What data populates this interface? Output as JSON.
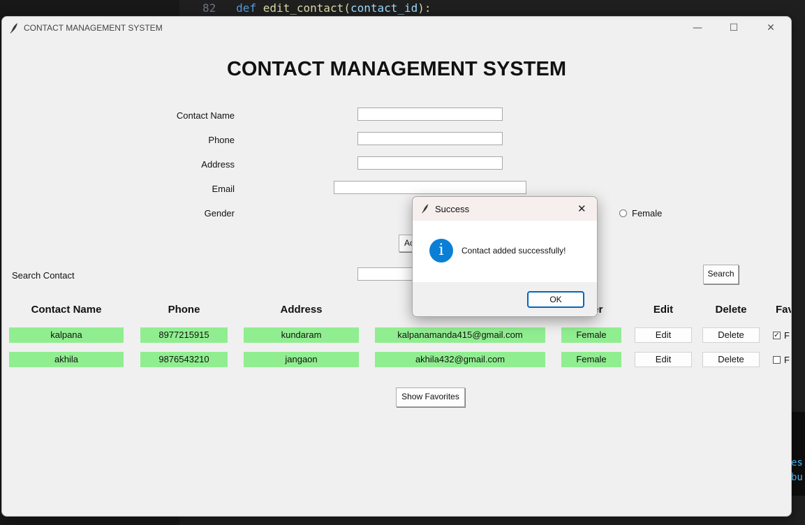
{
  "editor": {
    "line_number": "82",
    "code_def": "def",
    "code_fn": "edit_contact",
    "code_paren_open": "(",
    "code_param": "contact_id",
    "code_paren_close": "):",
    "right_text_1": "es",
    "right_text_2": "bu"
  },
  "window": {
    "title": "CONTACT MANAGEMENT SYSTEM",
    "minimize": "—",
    "maximize": "☐",
    "close": "✕"
  },
  "heading": "CONTACT MANAGEMENT SYSTEM",
  "form": {
    "name_label": "Contact Name",
    "phone_label": "Phone",
    "address_label": "Address",
    "email_label": "Email",
    "gender_label": "Gender",
    "female_label": "Female",
    "add_button_partial": "Ac"
  },
  "search": {
    "label": "Search Contact",
    "button": "Search"
  },
  "table": {
    "headers": {
      "name": "Contact Name",
      "phone": "Phone",
      "address": "Address",
      "gender_partial": "ler",
      "edit": "Edit",
      "delete": "Delete",
      "fav_partial": "Fav"
    },
    "rows": [
      {
        "name": "kalpana",
        "phone": "8977215915",
        "address": "kundaram",
        "email": "kalpanamanda415@gmail.com",
        "gender": "Female",
        "edit": "Edit",
        "delete": "Delete",
        "fav_checked": true,
        "fav_partial": "F"
      },
      {
        "name": "akhila",
        "phone": "9876543210",
        "address": "jangaon",
        "email": "akhila432@gmail.com",
        "gender": "Female",
        "edit": "Edit",
        "delete": "Delete",
        "fav_checked": false,
        "fav_partial": "F"
      }
    ]
  },
  "show_favorites": "Show Favorites",
  "dialog": {
    "title": "Success",
    "close": "✕",
    "message": "Contact added successfully!",
    "ok": "OK",
    "info_glyph": "i"
  },
  "colors": {
    "cell_bg": "#90ee90",
    "info_blue": "#0a7fd5",
    "dialog_title_bg": "#f7eeee"
  },
  "icons": {
    "app": "feather-icon",
    "dialog_app": "feather-icon",
    "info": "info-icon"
  }
}
